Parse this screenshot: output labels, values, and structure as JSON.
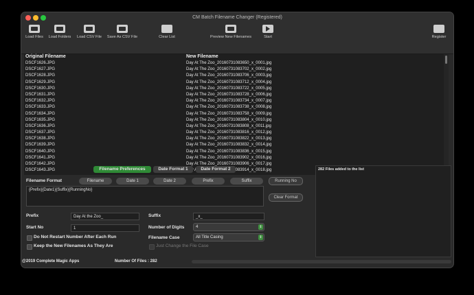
{
  "window": {
    "title": "CM Batch Filename Changer (Registered)"
  },
  "toolbar": {
    "load_files": "Load Files",
    "load_folders": "Load Folders",
    "load_csv": "Load CSV File",
    "save_csv": "Save As CSV File",
    "clear_list": "Clear List",
    "preview": "Preview New Filenames",
    "start": "Start",
    "register": "Register"
  },
  "list": {
    "col_original": "Original Filename",
    "col_new": "New Filename",
    "rows": [
      {
        "orig": "DSCF1626.JPG",
        "new": "Day At The Zoo_20160731083650_x_0001.jpg"
      },
      {
        "orig": "DSCF1627.JPG",
        "new": "Day At The Zoo_20160731083702_x_0002.jpg"
      },
      {
        "orig": "DSCF1628.JPG",
        "new": "Day At The Zoo_20160731083706_x_0003.jpg"
      },
      {
        "orig": "DSCF1629.JPG",
        "new": "Day At The Zoo_20160731083712_x_0004.jpg"
      },
      {
        "orig": "DSCF1630.JPG",
        "new": "Day At The Zoo_20160731083722_x_0005.jpg"
      },
      {
        "orig": "DSCF1631.JPG",
        "new": "Day At The Zoo_20160731083728_x_0006.jpg"
      },
      {
        "orig": "DSCF1632.JPG",
        "new": "Day At The Zoo_20160731083734_x_0007.jpg"
      },
      {
        "orig": "DSCF1633.JPG",
        "new": "Day At The Zoo_20160731083738_x_0008.jpg"
      },
      {
        "orig": "DSCF1634.JPG",
        "new": "Day At The Zoo_20160731083758_x_0009.jpg"
      },
      {
        "orig": "DSCF1635.JPG",
        "new": "Day At The Zoo_20160731083804_x_0010.jpg"
      },
      {
        "orig": "DSCF1636.JPG",
        "new": "Day At The Zoo_20160731083808_x_0011.jpg"
      },
      {
        "orig": "DSCF1637.JPG",
        "new": "Day At The Zoo_20160731083816_x_0012.jpg"
      },
      {
        "orig": "DSCF1638.JPG",
        "new": "Day At The Zoo_20160731083822_x_0013.jpg"
      },
      {
        "orig": "DSCF1639.JPG",
        "new": "Day At The Zoo_20160731083832_x_0014.jpg"
      },
      {
        "orig": "DSCF1640.JPG",
        "new": "Day At The Zoo_20160731083836_x_0015.jpg"
      },
      {
        "orig": "DSCF1641.JPG",
        "new": "Day At The Zoo_20160731083902_x_0016.jpg"
      },
      {
        "orig": "DSCF1642.JPG",
        "new": "Day At The Zoo_20160731083906_x_0017.jpg"
      },
      {
        "orig": "DSCF1643.JPG",
        "new": "Day At The Zoo_20160731083914_x_0018.jpg"
      }
    ]
  },
  "tabs": {
    "prefs": "Filename Preferences",
    "date1": "Date Format 1",
    "date2": "Date Format 2"
  },
  "format": {
    "label": "Filename Format",
    "btn_filename": "Filename",
    "btn_date1": "Date 1",
    "btn_date2": "Date 2",
    "btn_prefix": "Prefix",
    "btn_suffix": "Suffix",
    "btn_running": "Running No",
    "btn_clear": "Clear Format",
    "value": "{Prefix}{Date1}{Suffix}{RunningNo}"
  },
  "fields": {
    "prefix_label": "Prefix",
    "prefix_value": "Day At the Zoo_",
    "suffix_label": "Suffix",
    "suffix_value": "_x_",
    "startno_label": "Start No",
    "startno_value": "1",
    "digits_label": "Number of Digits",
    "digits_value": "4",
    "case_label": "Filename Case",
    "case_value": "All Title Casing"
  },
  "checks": {
    "no_restart": "Do Not Restart Number After Each Run",
    "keep_new": "Keep the New Filenames As They Are",
    "just_change_case": "Just Change the File Case"
  },
  "messages": {
    "text": "282 Files added to the list"
  },
  "status": {
    "copyright": "@2019 Complete Magic Apps",
    "file_count": "Number Of Files : 282"
  },
  "colors": {
    "active_tab": "#2f8a36",
    "accent_green": "#3f8f3f"
  }
}
